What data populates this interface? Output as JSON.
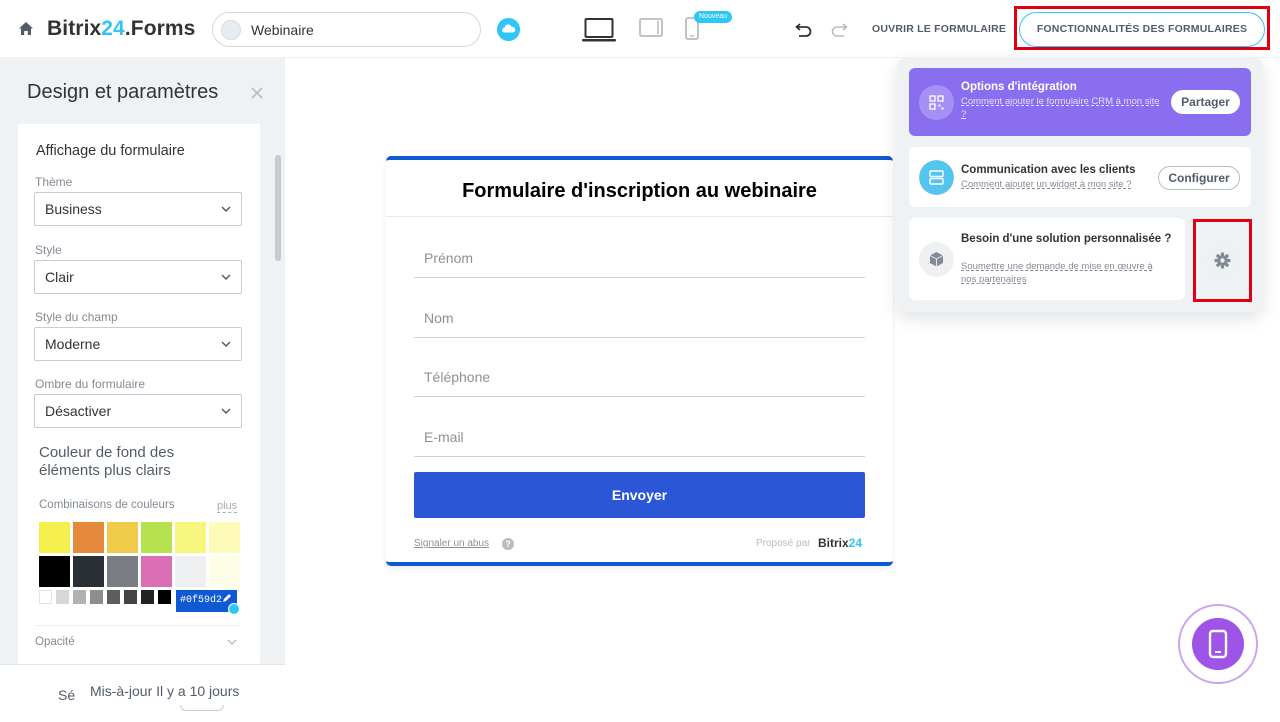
{
  "header": {
    "brand_name": "Bitrix",
    "brand_num": "24",
    "brand_suffix": ".Forms",
    "form_name": "Webinaire",
    "new_badge": "Nouveau",
    "open_form": "OUVRIR LE FORMULAIRE",
    "features": "FONCTIONNALITÉS DES FORMULAIRES"
  },
  "panel": {
    "title": "Design et paramètres",
    "section_display": "Affichage du formulaire",
    "theme_label": "Thème",
    "theme_value": "Business",
    "style_label": "Style",
    "style_value": "Clair",
    "field_style_label": "Style du champ",
    "field_style_value": "Moderne",
    "shadow_label": "Ombre du formulaire",
    "shadow_value": "Désactiver",
    "bg_section": "Couleur de fond des éléments plus clairs",
    "combos_label": "Combinaisons de couleurs",
    "combos_more": "plus",
    "swatches": [
      "#f5ef4e",
      "#e58a3c",
      "#f0cb4a",
      "#b6e24f",
      "#f6f57e",
      "#fdfbb7",
      "#000000",
      "#2a2f36",
      "#7a7e83",
      "#da6fb6",
      "#eeeff1",
      "#fefde6"
    ],
    "grays": [
      "#ffffff",
      "#d7d7d7",
      "#b1b1b1",
      "#8e8e8e",
      "#5d5d5d",
      "#444444",
      "#222222",
      "#000000"
    ],
    "selected_color": "#0f59d2",
    "opacity_label": "Opacité",
    "footer_save": "Sé",
    "footer_status": "Mis-à-jour Il y a 10 jours"
  },
  "form": {
    "title": "Formulaire d'inscription au webinaire",
    "fields": [
      "Prénom",
      "Nom",
      "Téléphone",
      "E-mail"
    ],
    "submit": "Envoyer",
    "report": "Signaler un abus",
    "help": "?",
    "powered": "Proposé par",
    "b24_brand": "Bitrix",
    "b24_num": "24"
  },
  "features_panel": {
    "integration_title": "Options d'intégration",
    "integration_sub": "Comment ajouter le formulaire CRM à mon site ?",
    "share_btn": "Partager",
    "comm_title": "Communication avec les clients",
    "comm_sub": "Comment ajouter un widget à mon site ?",
    "configure_btn": "Configurer",
    "custom_title": "Besoin d'une solution personnalisée ?",
    "custom_sub": "Soumettre une demande de mise en œuvre à nos partenaires"
  }
}
